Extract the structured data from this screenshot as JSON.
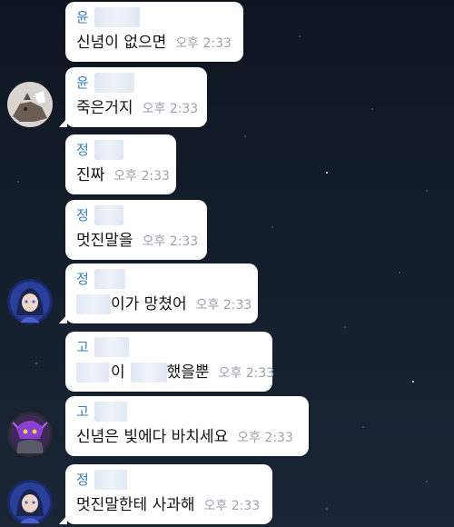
{
  "messages": [
    {
      "sender": "윤",
      "text": "신념이 없으면",
      "time": "오후 2:33"
    },
    {
      "sender": "윤",
      "text": "죽은거지",
      "time": "오후 2:33"
    },
    {
      "sender": "정",
      "text": "진짜",
      "time": "오후 2:33"
    },
    {
      "sender": "정",
      "text": "멋진말을",
      "time": "오후 2:33"
    },
    {
      "sender": "정",
      "text_suffix": "이가 망쳤어",
      "time": "오후 2:33"
    },
    {
      "sender": "고",
      "text_mid": "이",
      "text_suffix": "했을뿐",
      "time": "오후 2:33"
    },
    {
      "sender": "고",
      "text": "신념은 빛에다 바치세요",
      "time": "오후 2:33"
    },
    {
      "sender": "정",
      "text": "멋진말한테 사과해",
      "time": "오후 2:33"
    }
  ],
  "avatars": [
    "cat-avatar",
    "anime-girl-avatar",
    "purple-character-avatar",
    "anime-girl-avatar"
  ]
}
